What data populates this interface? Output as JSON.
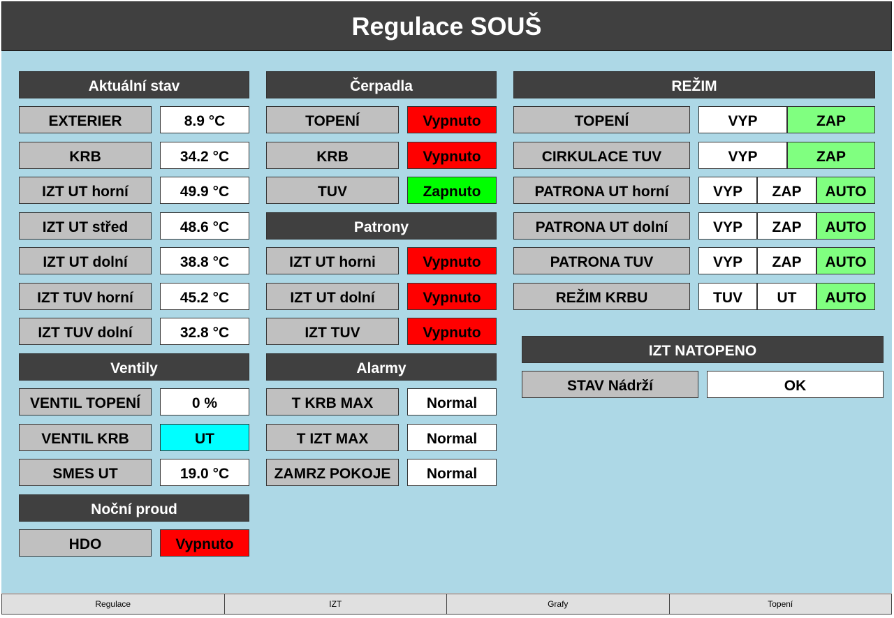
{
  "header": {
    "title": "Regulace SOUŠ"
  },
  "colors": {
    "header_bg": "#404040",
    "panel_bg": "#add8e6",
    "label_bg": "#c0c0c0",
    "off_red": "#ff0000",
    "on_green": "#00ff00",
    "selected_green": "#80ff80",
    "valve_cyan": "#00ffff"
  },
  "aktualni": {
    "title": "Aktuální stav",
    "rows": [
      {
        "label": "EXTERIER",
        "value": "8.9 °C"
      },
      {
        "label": "KRB",
        "value": "34.2 °C"
      },
      {
        "label": "IZT UT horní",
        "value": "49.9 °C"
      },
      {
        "label": "IZT UT střed",
        "value": "48.6 °C"
      },
      {
        "label": "IZT UT dolní",
        "value": "38.8 °C"
      },
      {
        "label": "IZT TUV horní",
        "value": "45.2 °C"
      },
      {
        "label": "IZT TUV dolní",
        "value": "32.8 °C"
      }
    ]
  },
  "ventily": {
    "title": "Ventily",
    "rows": [
      {
        "label": "VENTIL TOPENÍ",
        "value": "0 %"
      },
      {
        "label": "VENTIL KRB",
        "value": "UT"
      },
      {
        "label": "SMES UT",
        "value": "19.0 °C"
      }
    ]
  },
  "nocni": {
    "title": "Noční proud",
    "rows": [
      {
        "label": "HDO",
        "value": "Vypnuto"
      }
    ]
  },
  "cerpadla": {
    "title": "Čerpadla",
    "rows": [
      {
        "label": "TOPENÍ",
        "value": "Vypnuto"
      },
      {
        "label": "KRB",
        "value": "Vypnuto"
      },
      {
        "label": "TUV",
        "value": "Zapnuto"
      }
    ]
  },
  "patrony": {
    "title": "Patrony",
    "rows": [
      {
        "label": "IZT UT horni",
        "value": "Vypnuto"
      },
      {
        "label": "IZT UT dolní",
        "value": "Vypnuto"
      },
      {
        "label": "IZT TUV",
        "value": "Vypnuto"
      }
    ]
  },
  "alarmy": {
    "title": "Alarmy",
    "rows": [
      {
        "label": "T KRB MAX",
        "value": "Normal"
      },
      {
        "label": "T IZT MAX",
        "value": "Normal"
      },
      {
        "label": "ZAMRZ POKOJE",
        "value": "Normal"
      }
    ]
  },
  "rezim": {
    "title": "REŽIM",
    "rows": [
      {
        "label": "TOPENÍ",
        "options": [
          "VYP",
          "ZAP"
        ],
        "selected": "ZAP"
      },
      {
        "label": "CIRKULACE TUV",
        "options": [
          "VYP",
          "ZAP"
        ],
        "selected": "ZAP"
      },
      {
        "label": "PATRONA UT horní",
        "options": [
          "VYP",
          "ZAP",
          "AUTO"
        ],
        "selected": "AUTO"
      },
      {
        "label": "PATRONA UT dolní",
        "options": [
          "VYP",
          "ZAP",
          "AUTO"
        ],
        "selected": "AUTO"
      },
      {
        "label": "PATRONA TUV",
        "options": [
          "VYP",
          "ZAP",
          "AUTO"
        ],
        "selected": "AUTO"
      },
      {
        "label": "REŽIM KRBU",
        "options": [
          "TUV",
          "UT",
          "AUTO"
        ],
        "selected": "AUTO"
      }
    ]
  },
  "natopeno": {
    "title": "IZT NATOPENO",
    "label": "STAV Nádrží",
    "value": "OK"
  },
  "footer": {
    "tabs": [
      "Regulace",
      "IZT",
      "Grafy",
      "Topení"
    ]
  }
}
